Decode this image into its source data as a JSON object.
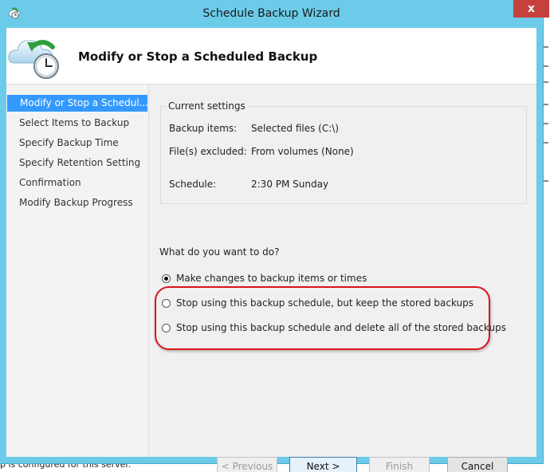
{
  "window": {
    "title": "Schedule Backup Wizard",
    "close_glyph": "x"
  },
  "header": {
    "title": "Modify or Stop a Scheduled Backup",
    "icon": "backup-schedule-clock-icon"
  },
  "nav": {
    "items": [
      {
        "label": "Modify or Stop a Schedul..."
      },
      {
        "label": "Select Items to Backup"
      },
      {
        "label": "Specify Backup Time"
      },
      {
        "label": "Specify Retention Setting"
      },
      {
        "label": "Confirmation"
      },
      {
        "label": "Modify Backup Progress"
      }
    ],
    "active_index": 0
  },
  "current_settings": {
    "title": "Current settings",
    "rows": [
      {
        "label": "Backup items:",
        "value": "Selected files (C:\\)"
      },
      {
        "label": "File(s) excluded:",
        "value": "From volumes (None)"
      },
      {
        "label": "Schedule:",
        "value": "2:30 PM Sunday"
      }
    ]
  },
  "choices": {
    "question": "What do you want to do?",
    "options": [
      {
        "label": "Make changes to backup items or times",
        "checked": true
      },
      {
        "label": "Stop using this backup schedule, but keep the stored backups",
        "checked": false
      },
      {
        "label": "Stop using this backup schedule and delete all of the stored backups",
        "checked": false
      }
    ]
  },
  "buttons": {
    "previous": "< Previous",
    "next": "Next >",
    "finish": "Finish",
    "cancel": "Cancel"
  },
  "background": {
    "bottom_text": "p is configured for this server."
  },
  "colors": {
    "titlebar": "#6bcbe9",
    "selection": "#3399ff",
    "highlight_annotation": "#d9141b",
    "close_button": "#c6413b"
  }
}
